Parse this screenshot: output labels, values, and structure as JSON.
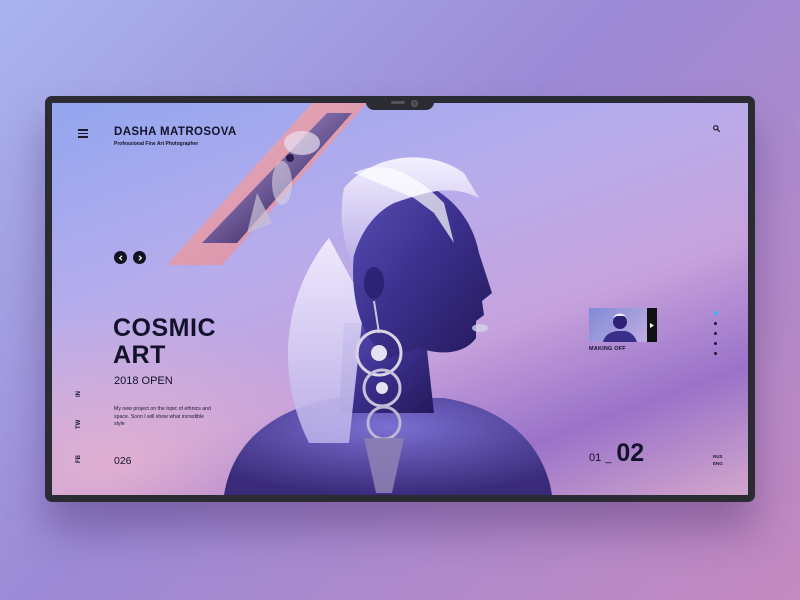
{
  "brand": {
    "name": "DASHA MATROSOVA",
    "tagline": "Professional Fine Art Photographer"
  },
  "hero": {
    "title_line1": "COSMIC",
    "title_line2": "ART",
    "subtitle": "2018 OPEN",
    "description": "My new project on the topic of ethnics and space. Soon I will show what incredible style"
  },
  "social": [
    "IN",
    "TW",
    "FB"
  ],
  "counter": "026",
  "video": {
    "label": "MAKING OFF"
  },
  "pager": {
    "current": "01",
    "separator": "_",
    "total": "02"
  },
  "languages": [
    "RUS",
    "ENG"
  ],
  "icons": {
    "menu": "menu-icon",
    "search": "search-icon",
    "prev": "chevron-left-icon",
    "next": "chevron-right-icon",
    "play": "play-icon"
  },
  "colors": {
    "accent_dot": "#3fb5ea",
    "text_dark": "#12122a",
    "device_frame": "#2b2b33"
  },
  "slides": {
    "count": 5,
    "active_index": 0
  }
}
